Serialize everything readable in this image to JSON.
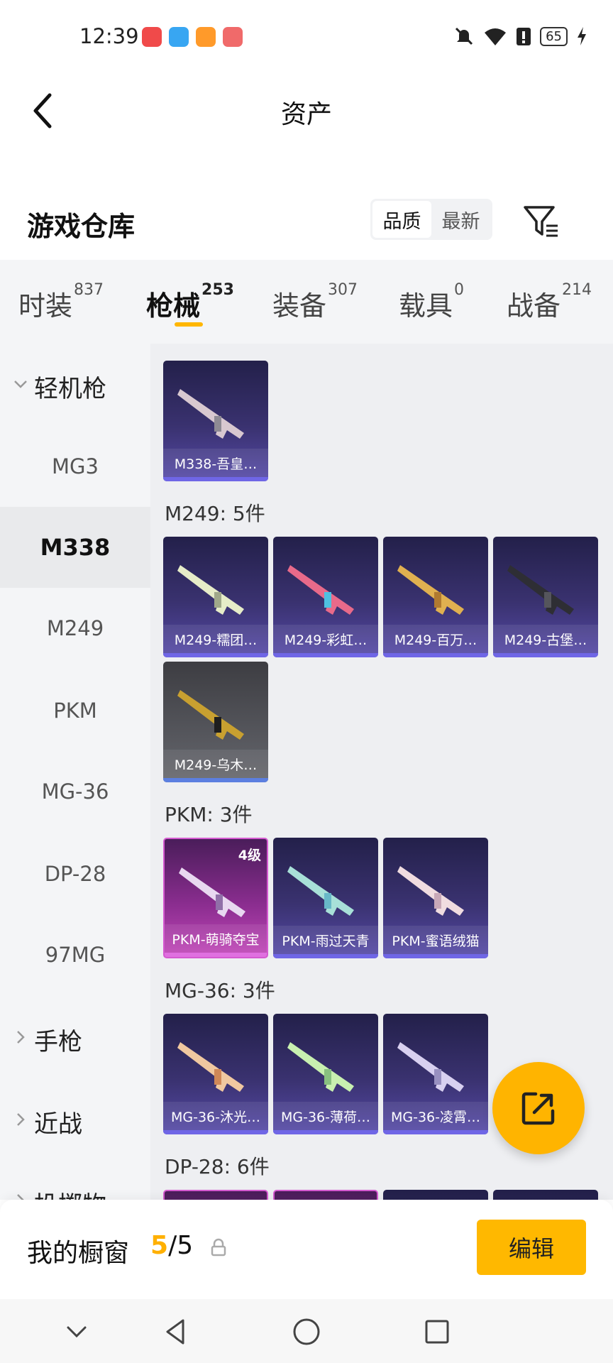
{
  "status_bar": {
    "time": "12:39",
    "battery": "65",
    "app_colors": [
      "#f04a4a",
      "#38a6f2",
      "#ff9a2a",
      "#f06a6a"
    ]
  },
  "header": {
    "title": "资产",
    "back_icon": "chevron-left-icon"
  },
  "warehouse": {
    "title": "游戏仓库",
    "sort_options": [
      "品质",
      "最新"
    ],
    "active_sort": "品质",
    "filter_icon": "filter-icon"
  },
  "tabs": [
    {
      "label": "时装",
      "count": "837"
    },
    {
      "label": "枪械",
      "count": "253"
    },
    {
      "label": "装备",
      "count": "307"
    },
    {
      "label": "载具",
      "count": "0"
    },
    {
      "label": "战备",
      "count": "214"
    }
  ],
  "active_tab": "枪械",
  "categories": {
    "group_lmg": "轻机枪",
    "lmg_items": [
      "MG3",
      "M338",
      "M249",
      "PKM",
      "MG-36",
      "DP-28",
      "97MG"
    ],
    "selected": "M338",
    "group_pistol": "手枪",
    "group_melee": "近战",
    "group_throwable": "投掷物"
  },
  "sections": [
    {
      "label": "",
      "items": [
        {
          "name": "M338-吾皇…",
          "style": "purple"
        }
      ]
    },
    {
      "label": "M249: 5件",
      "items": [
        {
          "name": "M249-糯团…",
          "style": "purple"
        },
        {
          "name": "M249-彩虹…",
          "style": "purple"
        },
        {
          "name": "M249-百万…",
          "style": "purple"
        },
        {
          "name": "M249-古堡…",
          "style": "purple"
        },
        {
          "name": "M249-乌木…",
          "style": "gray"
        }
      ]
    },
    {
      "label": "PKM: 3件",
      "items": [
        {
          "name": "PKM-萌骑夺宝",
          "style": "pink",
          "level": "4级"
        },
        {
          "name": "PKM-雨过天青",
          "style": "purple"
        },
        {
          "name": "PKM-蜜语绒猫",
          "style": "purple"
        }
      ]
    },
    {
      "label": "MG-36: 3件",
      "items": [
        {
          "name": "MG-36-沐光…",
          "style": "purple"
        },
        {
          "name": "MG-36-薄荷…",
          "style": "purple"
        },
        {
          "name": "MG-36-凌霄…",
          "style": "purple"
        }
      ]
    },
    {
      "label": "DP-28: 6件",
      "items": []
    }
  ],
  "showcase": {
    "title": "我的橱窗",
    "current": "5",
    "separator": "/",
    "total": "5",
    "edit_label": "编辑"
  },
  "colors": {
    "accent": "#ffb400",
    "rarity_purple": "#564aa8",
    "rarity_pink": "#c247b8",
    "rarity_gray": "#66676d"
  }
}
